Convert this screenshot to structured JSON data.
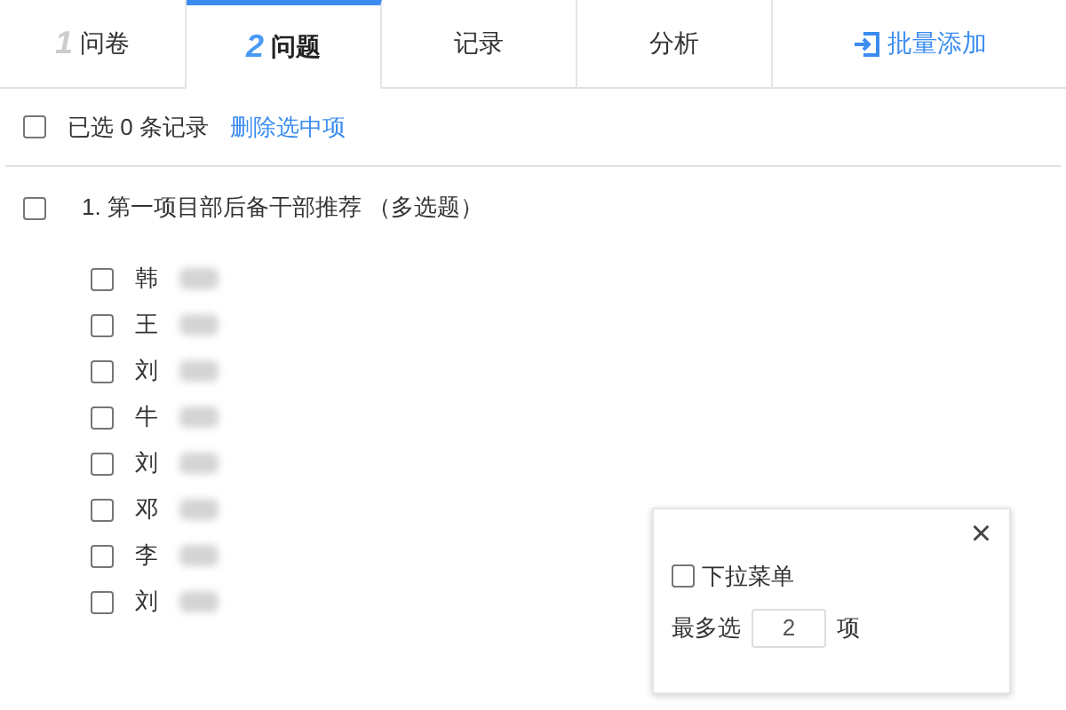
{
  "tabs": [
    {
      "number": "1",
      "label": "问卷",
      "selected": false
    },
    {
      "number": "2",
      "label": "问题",
      "selected": true
    },
    {
      "label": "记录",
      "selected": false
    },
    {
      "label": "分析",
      "selected": false
    }
  ],
  "batch_add": {
    "label": "批量添加"
  },
  "toolbar": {
    "checked": false,
    "selected_count": "已选 0 条记录",
    "delete_link": "删除选中项"
  },
  "question": {
    "checked": false,
    "title": "1. 第一项目部后备干部推荐 （多选题）",
    "options": [
      {
        "label": "韩",
        "checked": false
      },
      {
        "label": "王",
        "checked": false
      },
      {
        "label": "刘",
        "checked": false
      },
      {
        "label": "牛",
        "checked": false
      },
      {
        "label": "刘",
        "checked": false
      },
      {
        "label": "邓",
        "checked": false
      },
      {
        "label": "李",
        "checked": false
      },
      {
        "label": "刘",
        "checked": false
      }
    ]
  },
  "popup": {
    "close": "×",
    "dropdown": {
      "label": "下拉菜单",
      "checked": false
    },
    "max_label": "最多选",
    "max_value": "2",
    "max_unit": "项"
  }
}
